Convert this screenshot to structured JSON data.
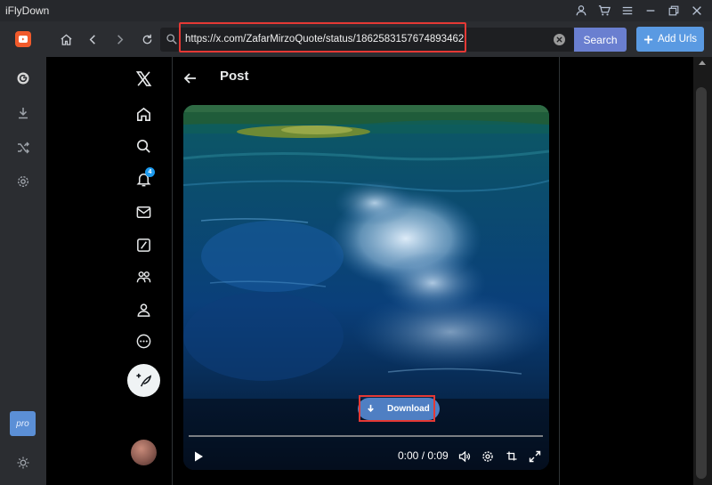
{
  "app": {
    "title": "iFlyDown"
  },
  "toolbar": {
    "url": "https://x.com/ZafarMirzoQuote/status/1862583157674893462",
    "search_label": "Search",
    "add_urls_label": "Add Urls"
  },
  "x_page": {
    "post_title": "Post",
    "notification_count": "4"
  },
  "video": {
    "download_label": "Download",
    "time": "0:00 / 0:09",
    "progress": 0
  },
  "sidebar": {
    "pro_label": "pro"
  },
  "colors": {
    "accent_search": "#6a7fd0",
    "accent_add": "#5a9ae2",
    "highlight": "#e53935",
    "brand": "#f15a2b"
  }
}
